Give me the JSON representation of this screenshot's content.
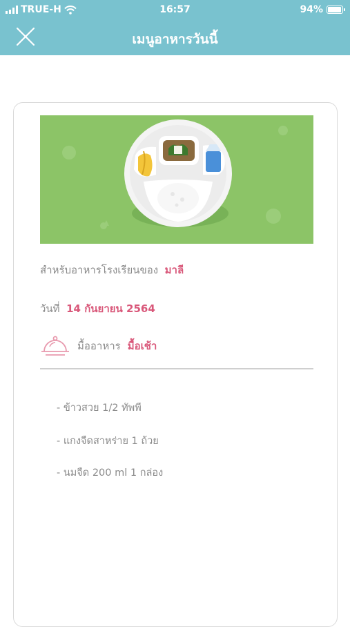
{
  "status_bar": {
    "carrier": "TRUE-H",
    "time": "16:57",
    "battery": "94%",
    "battery_level": 0.94
  },
  "header": {
    "title": "เมนูอาหารวันนี้",
    "close_icon": "close-icon",
    "background_color": "#79c2cf"
  },
  "card": {
    "for_label": "สำหรับอาหารโรงเรียนของ",
    "student_name": "มาลี",
    "date_label": "วันที่",
    "date_value": "14 กันยายน 2564",
    "meal_label": "มื้ออาหาร",
    "meal_value": "มื้อเช้า",
    "meal_icon": "food-cloche-icon",
    "accent_color": "#d9587a"
  },
  "menu_items": [
    "- ข้าวสวย 1/2 ทัพพี",
    "- แกงจืดสาหร่าย 1 ถ้วย",
    "- นมจืด 200 ml 1 กล่อง"
  ]
}
